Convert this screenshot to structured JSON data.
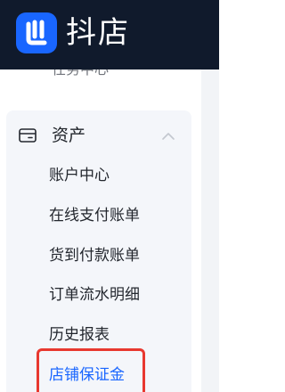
{
  "header": {
    "brand": "抖店"
  },
  "sidebar": {
    "cut_item": "任务中心",
    "group": {
      "title": "资产",
      "items": [
        {
          "label": "账户中心"
        },
        {
          "label": "在线支付账单"
        },
        {
          "label": "货到付款账单"
        },
        {
          "label": "订单流水明细"
        },
        {
          "label": "历史报表"
        },
        {
          "label": "店铺保证金",
          "active": true
        }
      ]
    }
  },
  "colors": {
    "header_bg": "#101a2c",
    "logo_bg": "#1966ff",
    "active_text": "#1966ff",
    "highlight_border": "#e8382f",
    "group_bg": "#f4f6fa"
  },
  "icons": {
    "logo": "doudian-logo-icon",
    "group": "wallet-icon",
    "toggle": "chevron-up-icon"
  }
}
